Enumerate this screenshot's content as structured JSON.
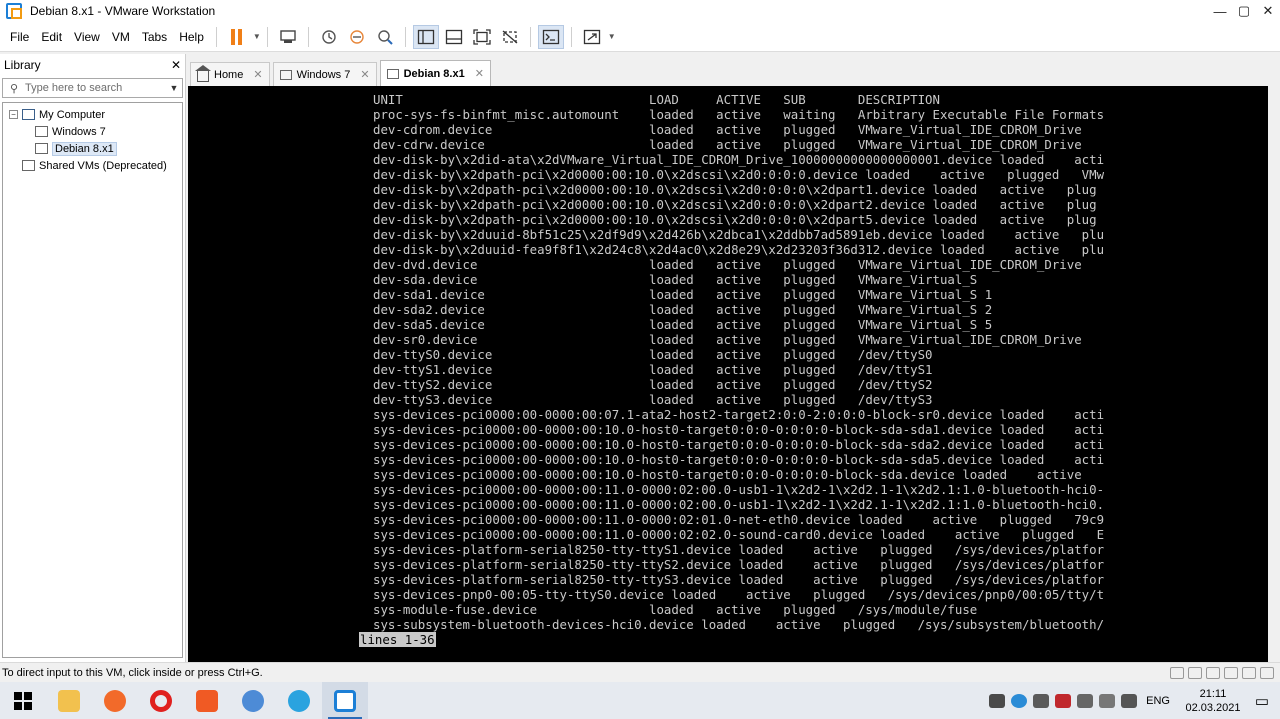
{
  "window": {
    "title": "Debian 8.x1 - VMware Workstation",
    "minimize": "—",
    "maximize": "▢",
    "close": "✕"
  },
  "menu": [
    "File",
    "Edit",
    "View",
    "VM",
    "Tabs",
    "Help"
  ],
  "library": {
    "title": "Library",
    "close": "✕",
    "search_placeholder": "Type here to search",
    "tree": {
      "root": "My Computer",
      "vms": [
        "Windows 7",
        "Debian 8.x1"
      ],
      "shared": "Shared VMs (Deprecated)"
    }
  },
  "tabs": [
    {
      "label": "Home",
      "active": false
    },
    {
      "label": "Windows 7",
      "active": false
    },
    {
      "label": "Debian 8.x1",
      "active": true
    }
  ],
  "console": {
    "lines": [
      "UNIT                                 LOAD     ACTIVE   SUB       DESCRIPTION",
      "proc-sys-fs-binfmt_misc.automount    loaded   active   waiting   Arbitrary Executable File Formats",
      "dev-cdrom.device                     loaded   active   plugged   VMware_Virtual_IDE_CDROM_Drive",
      "dev-cdrw.device                      loaded   active   plugged   VMware_Virtual_IDE_CDROM_Drive",
      "dev-disk-by\\x2did-ata\\x2dVMware_Virtual_IDE_CDROM_Drive_10000000000000000001.device loaded    acti",
      "dev-disk-by\\x2dpath-pci\\x2d0000:00:10.0\\x2dscsi\\x2d0:0:0:0.device loaded    active   plugged   VMw",
      "dev-disk-by\\x2dpath-pci\\x2d0000:00:10.0\\x2dscsi\\x2d0:0:0:0\\x2dpart1.device loaded   active   plug",
      "dev-disk-by\\x2dpath-pci\\x2d0000:00:10.0\\x2dscsi\\x2d0:0:0:0\\x2dpart2.device loaded   active   plug",
      "dev-disk-by\\x2dpath-pci\\x2d0000:00:10.0\\x2dscsi\\x2d0:0:0:0\\x2dpart5.device loaded   active   plug",
      "dev-disk-by\\x2duuid-8bf51c25\\x2df9d9\\x2d426b\\x2dbca1\\x2ddbb7ad5891eb.device loaded    active   plu",
      "dev-disk-by\\x2duuid-fea9f8f1\\x2d24c8\\x2d4ac0\\x2d8e29\\x2d23203f36d312.device loaded    active   plu",
      "dev-dvd.device                       loaded   active   plugged   VMware_Virtual_IDE_CDROM_Drive",
      "dev-sda.device                       loaded   active   plugged   VMware_Virtual_S",
      "dev-sda1.device                      loaded   active   plugged   VMware_Virtual_S 1",
      "dev-sda2.device                      loaded   active   plugged   VMware_Virtual_S 2",
      "dev-sda5.device                      loaded   active   plugged   VMware_Virtual_S 5",
      "dev-sr0.device                       loaded   active   plugged   VMware_Virtual_IDE_CDROM_Drive",
      "dev-ttyS0.device                     loaded   active   plugged   /dev/ttyS0",
      "dev-ttyS1.device                     loaded   active   plugged   /dev/ttyS1",
      "dev-ttyS2.device                     loaded   active   plugged   /dev/ttyS2",
      "dev-ttyS3.device                     loaded   active   plugged   /dev/ttyS3",
      "sys-devices-pci0000:00-0000:00:07.1-ata2-host2-target2:0:0-2:0:0:0-block-sr0.device loaded    acti",
      "sys-devices-pci0000:00-0000:00:10.0-host0-target0:0:0-0:0:0:0-block-sda-sda1.device loaded    acti",
      "sys-devices-pci0000:00-0000:00:10.0-host0-target0:0:0-0:0:0:0-block-sda-sda2.device loaded    acti",
      "sys-devices-pci0000:00-0000:00:10.0-host0-target0:0:0-0:0:0:0-block-sda-sda5.device loaded    acti",
      "sys-devices-pci0000:00-0000:00:10.0-host0-target0:0:0-0:0:0:0-block-sda.device loaded    active",
      "sys-devices-pci0000:00-0000:00:11.0-0000:02:00.0-usb1-1\\x2d2-1\\x2d2.1-1\\x2d2.1:1.0-bluetooth-hci0-",
      "sys-devices-pci0000:00-0000:00:11.0-0000:02:00.0-usb1-1\\x2d2-1\\x2d2.1-1\\x2d2.1:1.0-bluetooth-hci0.",
      "sys-devices-pci0000:00-0000:00:11.0-0000:02:01.0-net-eth0.device loaded    active   plugged   79c9",
      "sys-devices-pci0000:00-0000:00:11.0-0000:02:02.0-sound-card0.device loaded    active   plugged   E",
      "sys-devices-platform-serial8250-tty-ttyS1.device loaded    active   plugged   /sys/devices/platfor",
      "sys-devices-platform-serial8250-tty-ttyS2.device loaded    active   plugged   /sys/devices/platfor",
      "sys-devices-platform-serial8250-tty-ttyS3.device loaded    active   plugged   /sys/devices/platfor",
      "sys-devices-pnp0-00:05-tty-ttyS0.device loaded    active   plugged   /sys/devices/pnp0/00:05/tty/t",
      "sys-module-fuse.device               loaded   active   plugged   /sys/module/fuse",
      "sys-subsystem-bluetooth-devices-hci0.device loaded    active   plugged   /sys/subsystem/bluetooth/"
    ],
    "pager": "lines 1-36"
  },
  "status_bar": {
    "text": "To direct input to this VM, click inside or press Ctrl+G."
  },
  "taskbar": {
    "lang": "ENG",
    "time": "21:11",
    "date": "02.03.2021"
  }
}
